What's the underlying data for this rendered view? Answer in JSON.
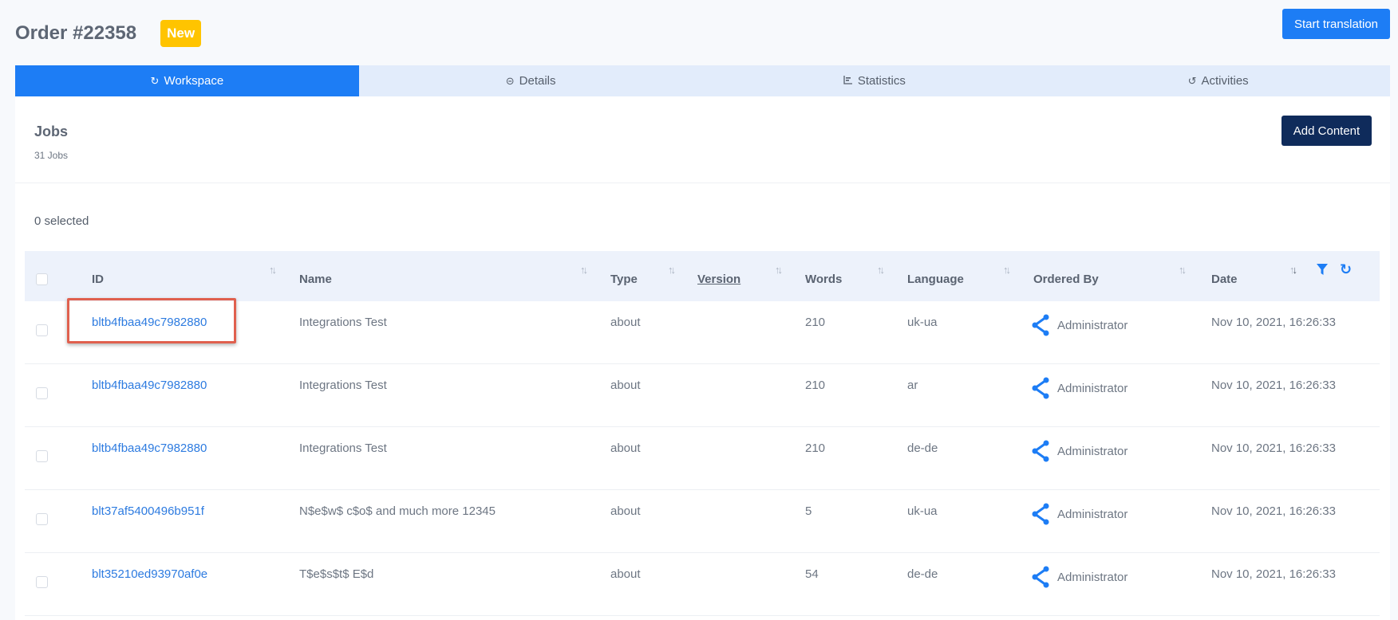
{
  "header": {
    "title": "Order #22358",
    "badge": "New",
    "start_button": "Start translation"
  },
  "tabs": [
    {
      "label": "Workspace",
      "icon": "refresh-icon"
    },
    {
      "label": "Details",
      "icon": "minus-circle-icon"
    },
    {
      "label": "Statistics",
      "icon": "bar-chart-icon"
    },
    {
      "label": "Activities",
      "icon": "history-icon"
    }
  ],
  "jobs": {
    "title": "Jobs",
    "count_label": "31 Jobs",
    "add_button": "Add Content",
    "selected_label": "0 selected"
  },
  "table": {
    "columns": [
      "ID",
      "Name",
      "Type",
      "Version",
      "Words",
      "Language",
      "Ordered By",
      "Date"
    ],
    "rows": [
      {
        "id": "bltb4fbaa49c7982880",
        "name": "Integrations Test",
        "type": "about",
        "version": "",
        "words": "210",
        "language": "uk-ua",
        "ordered_by": "Administrator",
        "date": "Nov 10, 2021, 16:26:33"
      },
      {
        "id": "bltb4fbaa49c7982880",
        "name": "Integrations Test",
        "type": "about",
        "version": "",
        "words": "210",
        "language": "ar",
        "ordered_by": "Administrator",
        "date": "Nov 10, 2021, 16:26:33"
      },
      {
        "id": "bltb4fbaa49c7982880",
        "name": "Integrations Test",
        "type": "about",
        "version": "",
        "words": "210",
        "language": "de-de",
        "ordered_by": "Administrator",
        "date": "Nov 10, 2021, 16:26:33"
      },
      {
        "id": "blt37af5400496b951f",
        "name": "N$e$w$ c$o$ and much more 12345",
        "type": "about",
        "version": "",
        "words": "5",
        "language": "uk-ua",
        "ordered_by": "Administrator",
        "date": "Nov 10, 2021, 16:26:33"
      },
      {
        "id": "blt35210ed93970af0e",
        "name": "T$e$s$t$ E$d",
        "type": "about",
        "version": "",
        "words": "54",
        "language": "de-de",
        "ordered_by": "Administrator",
        "date": "Nov 10, 2021, 16:26:33"
      }
    ]
  },
  "colors": {
    "accent": "#1d7df5",
    "dark_button": "#0f2b5b",
    "badge": "#ffc400",
    "highlight": "#e0604e",
    "link": "#2d7be0"
  }
}
